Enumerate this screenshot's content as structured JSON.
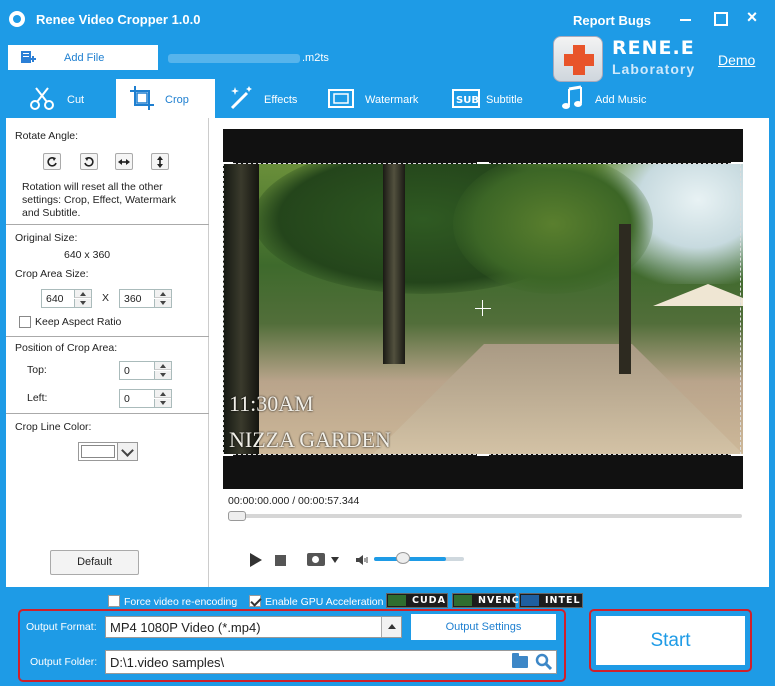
{
  "window": {
    "title": "Renee Video Cropper 1.0.0",
    "report_bugs": "Report Bugs",
    "close_glyph": "×"
  },
  "file": {
    "add_file_label": "Add File",
    "filename_suffix": ".m2ts"
  },
  "logo": {
    "brand": "RENE.E",
    "sub": "Laboratory",
    "demo_link": "Demo"
  },
  "tabs": [
    {
      "label": "Cut",
      "icon": "scissors-icon",
      "active": false
    },
    {
      "label": "Crop",
      "icon": "crop-icon",
      "active": true
    },
    {
      "label": "Effects",
      "icon": "magic-wand-icon",
      "active": false
    },
    {
      "label": "Watermark",
      "icon": "watermark-icon",
      "active": false
    },
    {
      "label": "Subtitle",
      "icon": "subtitle-icon",
      "active": false
    },
    {
      "label": "Add Music",
      "icon": "music-note-icon",
      "active": false
    }
  ],
  "crop_panel": {
    "rotate_angle_label": "Rotate Angle:",
    "rotation_note_1": "Rotation will reset all the other",
    "rotation_note_2": "settings: Crop, Effect, Watermark",
    "rotation_note_3": "and Subtitle.",
    "original_size_label": "Original Size:",
    "original_size_value": "640 x 360",
    "crop_area_size_label": "Crop Area Size:",
    "crop_width": "640",
    "crop_x": "X",
    "crop_height": "360",
    "keep_aspect_label": "Keep Aspect Ratio",
    "keep_aspect_checked": false,
    "position_label": "Position of Crop Area:",
    "top_label": "Top:",
    "top_value": "0",
    "left_label": "Left:",
    "left_value": "0",
    "crop_line_color_label": "Crop Line Color:",
    "crop_line_color": "#ffffff",
    "default_button": "Default"
  },
  "video": {
    "overlay_time": "11:30AM",
    "overlay_place": "NIZZA GARDEN"
  },
  "player": {
    "timecode": "00:00:00.000 / 00:00:57.344",
    "volume_level": 0.8
  },
  "bottom": {
    "force_reencode_label": "Force video re-encoding",
    "force_reencode_checked": false,
    "gpu_accel_label": "Enable GPU Acceleration",
    "gpu_accel_checked": true,
    "gpu_badges": [
      "CUDA",
      "NVENC",
      "INTEL"
    ],
    "output_format_label": "Output Format:",
    "output_format_value": "MP4 1080P Video (*.mp4)",
    "output_settings_button": "Output Settings",
    "output_folder_label": "Output Folder:",
    "output_folder_value": "D:\\1.video samples\\",
    "start_button": "Start"
  },
  "colors": {
    "accent": "#1e9be6",
    "highlight_border": "#d0202a"
  }
}
